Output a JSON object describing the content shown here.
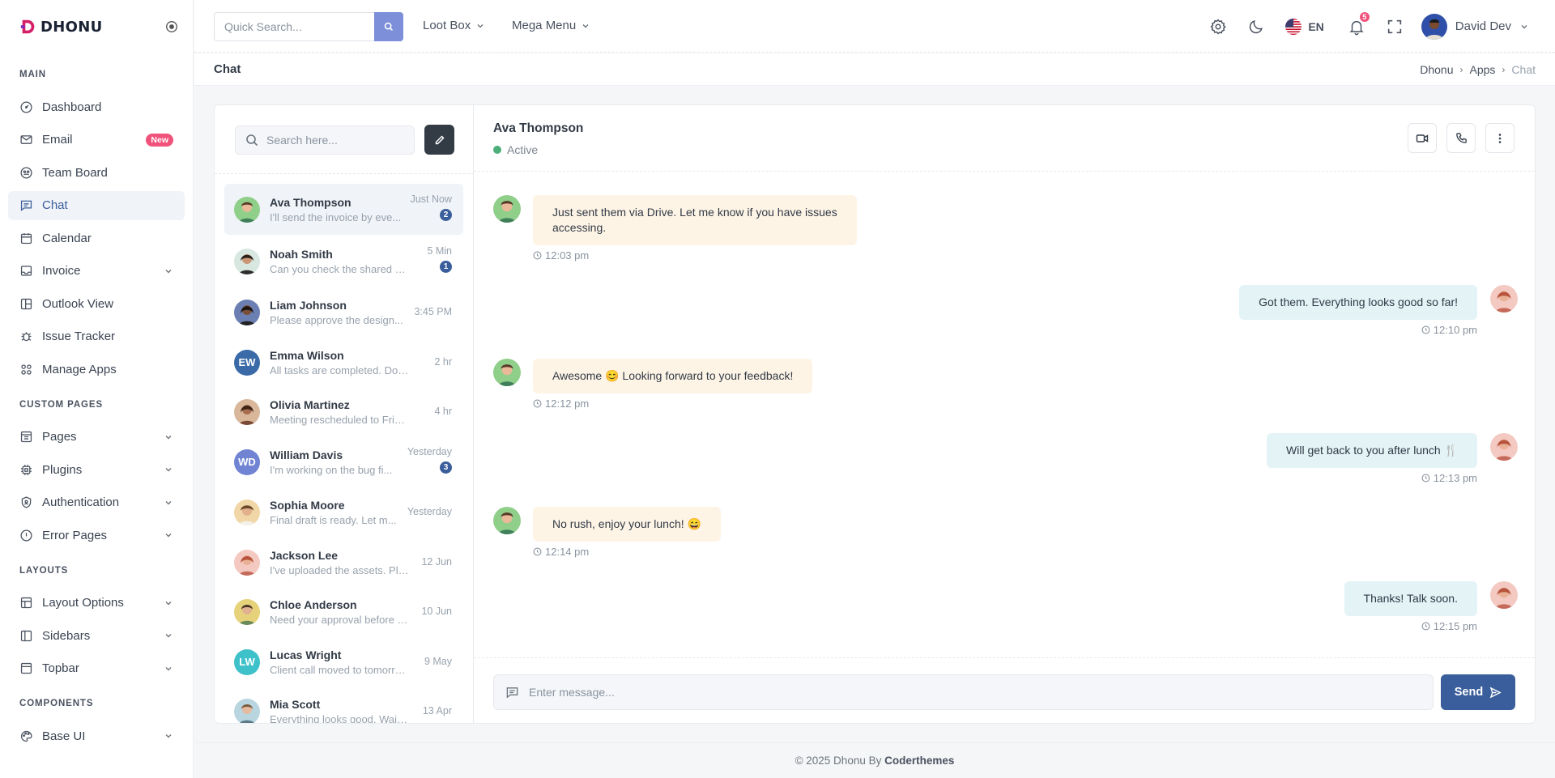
{
  "brand": {
    "name": "DHONU"
  },
  "sidebar": {
    "sections": [
      {
        "title": "MAIN"
      },
      {
        "title": "CUSTOM PAGES"
      },
      {
        "title": "LAYOUTS"
      },
      {
        "title": "COMPONENTS"
      }
    ],
    "items": [
      {
        "label": "Dashboard",
        "icon": "dashboard-icon"
      },
      {
        "label": "Email",
        "icon": "mail-icon",
        "badge": "New"
      },
      {
        "label": "Team Board",
        "icon": "team-icon"
      },
      {
        "label": "Chat",
        "icon": "chat-icon",
        "active": true
      },
      {
        "label": "Calendar",
        "icon": "calendar-icon"
      },
      {
        "label": "Invoice",
        "icon": "invoice-icon"
      },
      {
        "label": "Outlook View",
        "icon": "layout-icon"
      },
      {
        "label": "Issue Tracker",
        "icon": "bug-icon"
      },
      {
        "label": "Manage Apps",
        "icon": "apps-icon"
      },
      {
        "label": "Pages",
        "icon": "pages-icon"
      },
      {
        "label": "Plugins",
        "icon": "plugin-icon"
      },
      {
        "label": "Authentication",
        "icon": "shield-icon"
      },
      {
        "label": "Error Pages",
        "icon": "alert-icon"
      },
      {
        "label": "Layout Options",
        "icon": "layout-icon"
      },
      {
        "label": "Sidebars",
        "icon": "sidebar-icon"
      },
      {
        "label": "Topbar",
        "icon": "topbar-icon"
      },
      {
        "label": "Base UI",
        "icon": "palette-icon"
      }
    ]
  },
  "topbar": {
    "search_placeholder": "Quick Search...",
    "menu1": "Loot Box",
    "menu2": "Mega Menu",
    "language": "EN",
    "notifications": "5",
    "user_name": "David Dev"
  },
  "page": {
    "title": "Chat",
    "breadcrumb": [
      "Dhonu",
      "Apps",
      "Chat"
    ]
  },
  "chat_list": {
    "search_placeholder": "Search here...",
    "conversations": [
      {
        "name": "Ava Thompson",
        "preview": "I'll send the invoice by eve...",
        "time": "Just Now",
        "unread": "2",
        "active": true
      },
      {
        "name": "Noah Smith",
        "preview": "Can you check the shared do...",
        "time": "5 Min",
        "unread": "1"
      },
      {
        "name": "Liam Johnson",
        "preview": "Please approve the design...",
        "time": "3:45 PM"
      },
      {
        "name": "Emma Wilson",
        "preview": "All tasks are completed. Do yo...",
        "time": "2 hr",
        "initials": "EW"
      },
      {
        "name": "Olivia Martinez",
        "preview": "Meeting rescheduled to Friday ...",
        "time": "4 hr"
      },
      {
        "name": "William Davis",
        "preview": "I'm working on the bug fi...",
        "time": "Yesterday",
        "unread": "3",
        "initials": "WD"
      },
      {
        "name": "Sophia Moore",
        "preview": "Final draft is ready. Let m...",
        "time": "Yesterday"
      },
      {
        "name": "Jackson Lee",
        "preview": "I've uploaded the assets. Ple...",
        "time": "12 Jun"
      },
      {
        "name": "Chloe Anderson",
        "preview": "Need your approval before p...",
        "time": "10 Jun"
      },
      {
        "name": "Lucas Wright",
        "preview": "Client call moved to tomorro...",
        "time": "9 May",
        "initials": "LW"
      },
      {
        "name": "Mia Scott",
        "preview": "Everything looks good. Waiti...",
        "time": "13 Apr"
      }
    ]
  },
  "chat": {
    "contact_name": "Ava Thompson",
    "status": "Active",
    "messages": [
      {
        "dir": "in",
        "text": "Just sent them via Drive. Let me know if you have issues accessing.",
        "time": "12:03 pm"
      },
      {
        "dir": "out",
        "text": "Got them. Everything looks good so far!",
        "time": "12:10 pm"
      },
      {
        "dir": "in",
        "text": "Awesome 😊 Looking forward to your feedback!",
        "time": "12:12 pm"
      },
      {
        "dir": "out",
        "text": "Will get back to you after lunch 🍴",
        "time": "12:13 pm"
      },
      {
        "dir": "in",
        "text": "No rush, enjoy your lunch! 😄",
        "time": "12:14 pm"
      },
      {
        "dir": "out",
        "text": "Thanks! Talk soon.",
        "time": "12:15 pm"
      }
    ],
    "input_placeholder": "Enter message...",
    "send_label": "Send"
  },
  "footer": {
    "text": "© 2025 Dhonu By ",
    "brand": "Coderthemes"
  },
  "colors": {
    "primary": "#3a5e9b",
    "accent": "#f0527c",
    "incoming": "#fef4e6",
    "outgoing": "#e3f3f6"
  }
}
